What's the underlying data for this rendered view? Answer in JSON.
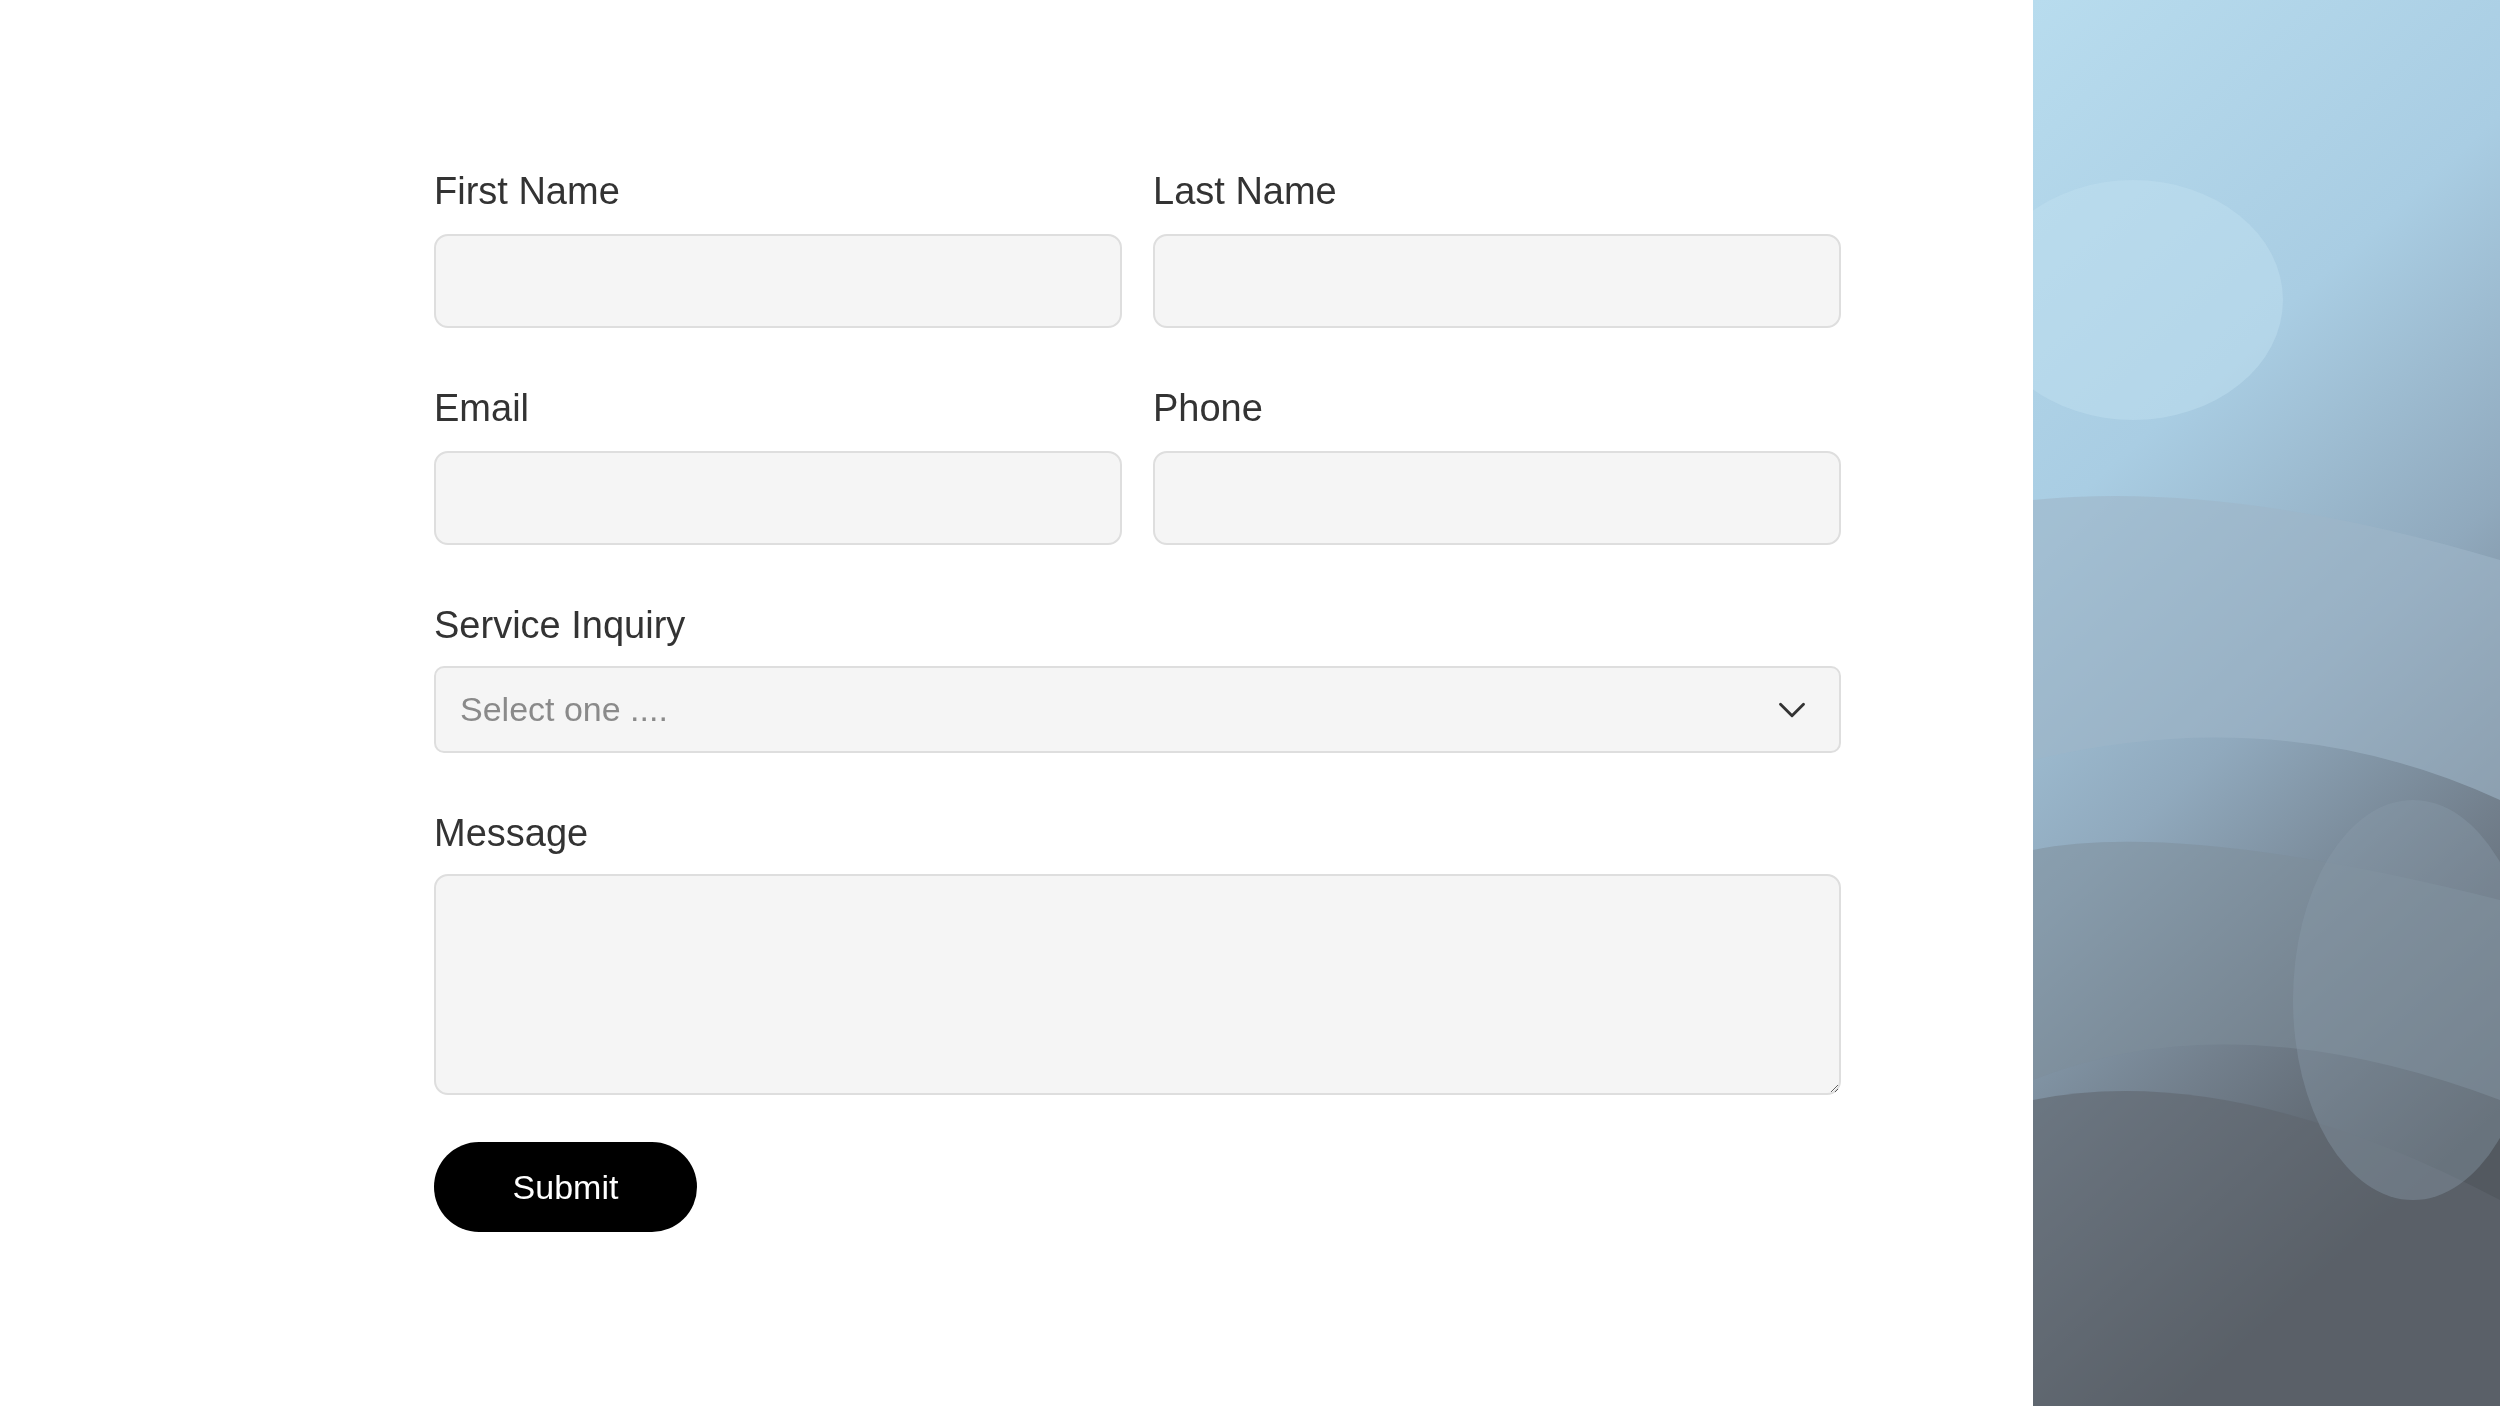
{
  "form": {
    "fields": [
      {
        "kind": "text",
        "label": "First Name"
      },
      {
        "kind": "text",
        "label": "Last Name"
      },
      {
        "kind": "text",
        "label": "Email"
      },
      {
        "kind": "text",
        "label": "Phone"
      },
      {
        "kind": "select",
        "label": "Service Inquiry",
        "placeholder": "Select one ...."
      },
      {
        "kind": "textarea",
        "label": "Message"
      }
    ],
    "submit": "Submit"
  }
}
